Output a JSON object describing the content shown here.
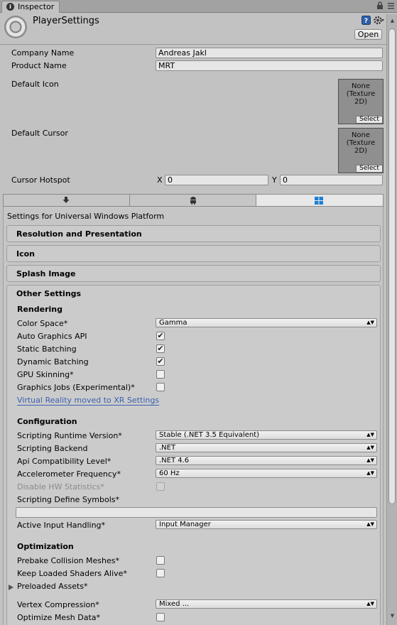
{
  "window": {
    "tab_title": "Inspector"
  },
  "header": {
    "title": "PlayerSettings",
    "open_label": "Open"
  },
  "general": {
    "company_label": "Company Name",
    "company_value": "Andreas Jakl",
    "product_label": "Product Name",
    "product_value": "MRT",
    "icon_label": "Default Icon",
    "icon_none": "None",
    "icon_type": "(Texture",
    "icon_type2": "2D)",
    "icon_select": "Select",
    "cursor_label": "Default Cursor",
    "cursor_none": "None",
    "cursor_type": "(Texture",
    "cursor_type2": "2D)",
    "cursor_select": "Select",
    "hotspot_label": "Cursor Hotspot",
    "x_label": "X",
    "x_value": "0",
    "y_label": "Y",
    "y_value": "0"
  },
  "platform": {
    "tabs": [
      "standalone-icon",
      "android-icon",
      "windows-icon"
    ],
    "active_tab": 2,
    "heading": "Settings for Universal Windows Platform"
  },
  "sections": {
    "resolution": "Resolution and Presentation",
    "icon": "Icon",
    "splash": "Splash Image",
    "other": "Other Settings"
  },
  "rendering": {
    "title": "Rendering",
    "color_space_label": "Color Space*",
    "color_space_value": "Gamma",
    "auto_gfx_label": "Auto Graphics API",
    "static_batching_label": "Static Batching",
    "dynamic_batching_label": "Dynamic Batching",
    "gpu_skinning_label": "GPU Skinning*",
    "graphics_jobs_label": "Graphics Jobs (Experimental)*",
    "vr_link": "Virtual Reality moved to XR Settings"
  },
  "configuration": {
    "title": "Configuration",
    "runtime_label": "Scripting Runtime Version*",
    "runtime_value": "Stable (.NET 3.5 Equivalent)",
    "backend_label": "Scripting Backend",
    "backend_value": ".NET",
    "api_label": "Api Compatibility Level*",
    "api_value": ".NET 4.6",
    "accel_label": "Accelerometer Frequency*",
    "accel_value": "60 Hz",
    "hwstats_label": "Disable HW Statistics*",
    "define_label": "Scripting Define Symbols*",
    "define_value": "",
    "input_label": "Active Input Handling*",
    "input_value": "Input Manager"
  },
  "optimization": {
    "title": "Optimization",
    "prebake_label": "Prebake Collision Meshes*",
    "keep_shaders_label": "Keep Loaded Shaders Alive*",
    "preloaded_label": "Preloaded Assets*",
    "vertex_label": "Vertex Compression*",
    "vertex_value": "Mixed ...",
    "optimize_mesh_label": "Optimize Mesh Data*"
  },
  "checkbox_mark": "✔",
  "dropdown_arrow": "▲▼"
}
